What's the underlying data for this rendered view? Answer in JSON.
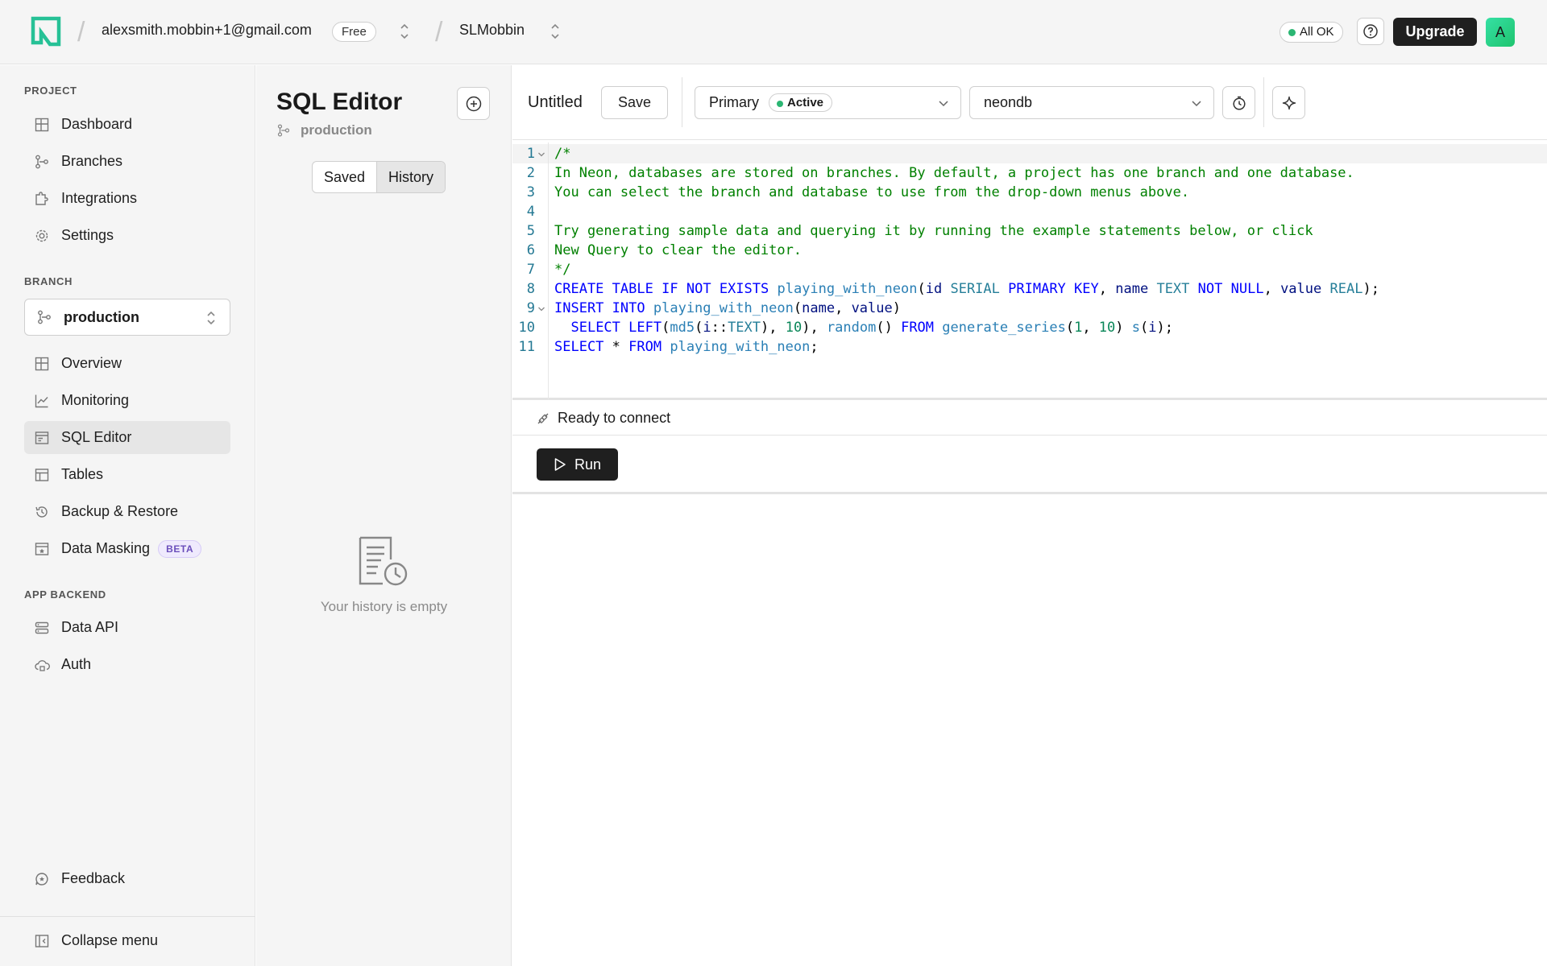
{
  "topbar": {
    "account_email": "alexsmith.mobbin+1@gmail.com",
    "plan_badge": "Free",
    "project_name": "SLMobbin",
    "status_label": "All OK",
    "upgrade_label": "Upgrade",
    "avatar_initial": "A"
  },
  "sidebar": {
    "project_section": "PROJECT",
    "project_items": [
      "Dashboard",
      "Branches",
      "Integrations",
      "Settings"
    ],
    "branch_section": "BRANCH",
    "branch_selected": "production",
    "branch_items": [
      "Overview",
      "Monitoring",
      "SQL Editor",
      "Tables",
      "Backup & Restore",
      "Data Masking"
    ],
    "beta_badge": "BETA",
    "app_section": "APP BACKEND",
    "app_items": [
      "Data API",
      "Auth"
    ],
    "feedback_label": "Feedback",
    "collapse_label": "Collapse menu"
  },
  "history_panel": {
    "title": "SQL Editor",
    "branch": "production",
    "tabs": [
      "Saved",
      "History"
    ],
    "selected_tab": "History",
    "empty_text": "Your history is empty"
  },
  "editor": {
    "query_title": "Untitled",
    "save_label": "Save",
    "branch_dropdown": "Primary",
    "branch_status": "Active",
    "database_dropdown": "neondb",
    "status_text": "Ready to connect",
    "run_label": "Run",
    "line_numbers": [
      "1",
      "2",
      "3",
      "4",
      "5",
      "6",
      "7",
      "8",
      "9",
      "10",
      "11"
    ],
    "code_lines": [
      "/*",
      "In Neon, databases are stored on branches. By default, a project has one branch and one database.",
      "You can select the branch and database to use from the drop-down menus above.",
      "",
      "Try generating sample data and querying it by running the example statements below, or click",
      "New Query to clear the editor.",
      "*/",
      "CREATE TABLE IF NOT EXISTS playing_with_neon(id SERIAL PRIMARY KEY, name TEXT NOT NULL, value REAL);",
      "INSERT INTO playing_with_neon(name, value)",
      "  SELECT LEFT(md5(i::TEXT), 10), random() FROM generate_series(1, 10) s(i);",
      "SELECT * FROM playing_with_neon;"
    ]
  },
  "colors": {
    "accent_green": "#2bb673",
    "dark_button": "#1f1f1f",
    "comment_green": "#008000",
    "keyword_blue": "#0000ff"
  }
}
